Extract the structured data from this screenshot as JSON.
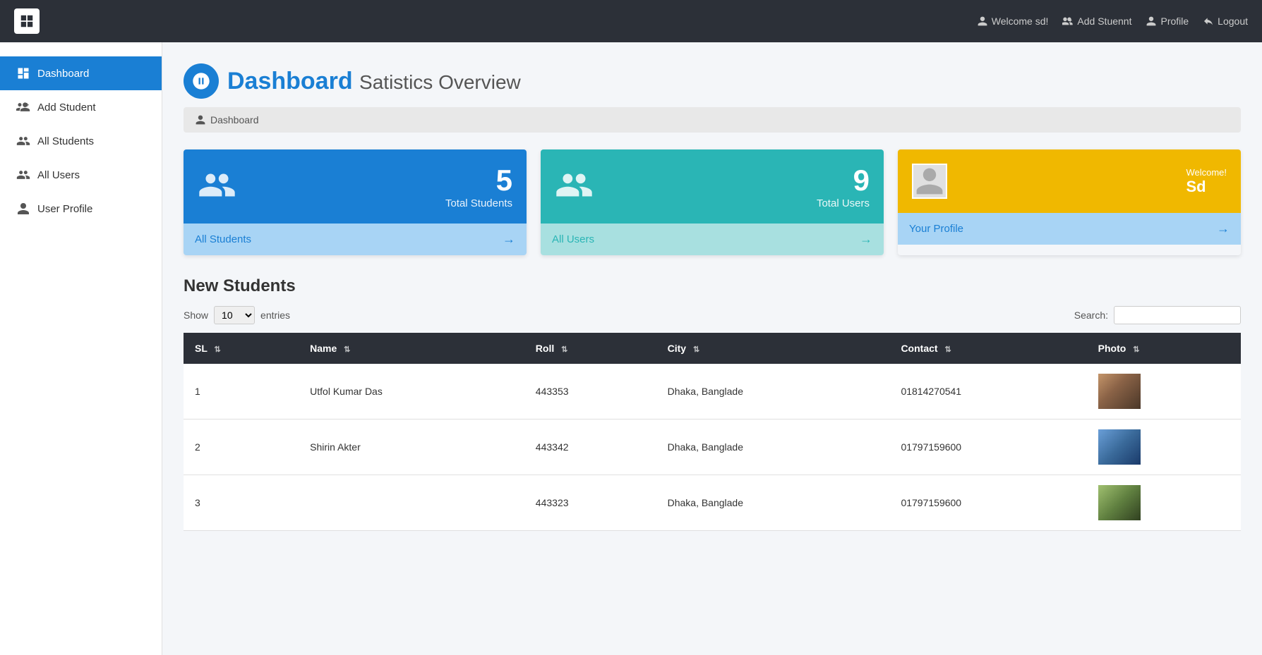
{
  "navbar": {
    "brand": "",
    "welcome_label": "Welcome sd!",
    "add_student_label": "Add Stuennt",
    "profile_label": "Profile",
    "logout_label": "Logout"
  },
  "sidebar": {
    "items": [
      {
        "id": "dashboard",
        "label": "Dashboard",
        "active": true
      },
      {
        "id": "add-student",
        "label": "Add Student",
        "active": false
      },
      {
        "id": "all-students",
        "label": "All Students",
        "active": false
      },
      {
        "id": "all-users",
        "label": "All Users",
        "active": false
      },
      {
        "id": "user-profile",
        "label": "User Profile",
        "active": false
      }
    ]
  },
  "page": {
    "title": "Dashboard",
    "subtitle": "Satistics Overview",
    "breadcrumb": "Dashboard"
  },
  "stats": {
    "students": {
      "count": "5",
      "label": "Total Students",
      "link_label": "All Students"
    },
    "users": {
      "count": "9",
      "label": "Total Users",
      "link_label": "All Users"
    },
    "profile": {
      "welcome_label": "Welcome!",
      "name": "Sd",
      "link_label": "Your Profile"
    }
  },
  "table": {
    "title": "New Students",
    "show_label": "Show",
    "entries_label": "entries",
    "search_label": "Search:",
    "entries_value": "10",
    "columns": [
      "SL",
      "Name",
      "Roll",
      "City",
      "Contact",
      "Photo"
    ],
    "rows": [
      {
        "sl": "1",
        "name": "Utfol Kumar Das",
        "roll": "443353",
        "city": "Dhaka, Banglade",
        "contact": "01814270541"
      },
      {
        "sl": "2",
        "name": "Shirin Akter",
        "roll": "443342",
        "city": "Dhaka, Banglade",
        "contact": "01797159600"
      },
      {
        "sl": "3",
        "name": "",
        "roll": "443323",
        "city": "Dhaka, Banglade",
        "contact": "01797159600"
      }
    ]
  }
}
